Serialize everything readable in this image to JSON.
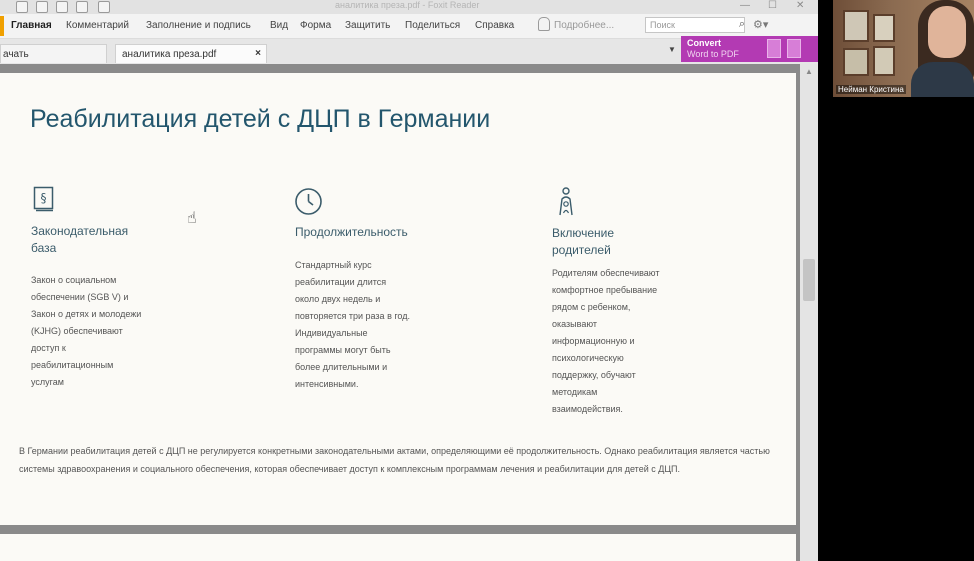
{
  "app": {
    "window_title": "аналитика преза.pdf - Foxit Reader",
    "menu": [
      "Главная",
      "Комментарий",
      "Заполнение и подпись",
      "Вид",
      "Форма",
      "Защитить",
      "Поделиться",
      "Справка"
    ],
    "tell_me": "Подробнее...",
    "search_placeholder": "Поиск",
    "tabs": [
      {
        "label": "ачать"
      },
      {
        "label": "аналитика преза.pdf",
        "close": "×"
      }
    ],
    "convert": {
      "line1": "Convert",
      "line2": "Word to PDF"
    }
  },
  "slide": {
    "title": "Реабилитация детей с ДЦП в Германии",
    "columns": [
      {
        "icon": "law-book-icon",
        "icon_glyph": "§",
        "heading": [
          "Законодательная",
          "база"
        ],
        "text": [
          "Закон о социальном",
          "обеспечении (SGB V) и",
          "Закон о детях и молодежи",
          "(KJHG) обеспечивают",
          "доступ к",
          "реабилитационным",
          "услугам"
        ]
      },
      {
        "icon": "clock-icon",
        "heading": [
          "Продолжительность"
        ],
        "text": [
          "Стандартный курс",
          "реабилитации длится",
          "около двух недель и",
          "повторяется три раза в год.",
          "Индивидуальные",
          "программы могут быть",
          "более длительными и",
          "интенсивными."
        ]
      },
      {
        "icon": "parent-child-icon",
        "heading": [
          "Включение",
          "родителей"
        ],
        "text": [
          "Родителям обеспечивают",
          "комфортное пребывание",
          "рядом с ребенком,",
          "оказывают",
          "информационную и",
          "психологическую",
          "поддержку, обучают",
          "методикам",
          "взаимодействия."
        ]
      }
    ],
    "bottom_text": "В Германии реабилитация детей с ДЦП не регулируется конкретными законодательными актами, определяющими её продолжительность. Однако реабилитация является частью системы здравоохранения и социального обеспечения, которая обеспечивает доступ к комплексным программам лечения и реабилитации для детей с ДЦП."
  },
  "webcam": {
    "participant_name": "Нейман Кристина"
  }
}
